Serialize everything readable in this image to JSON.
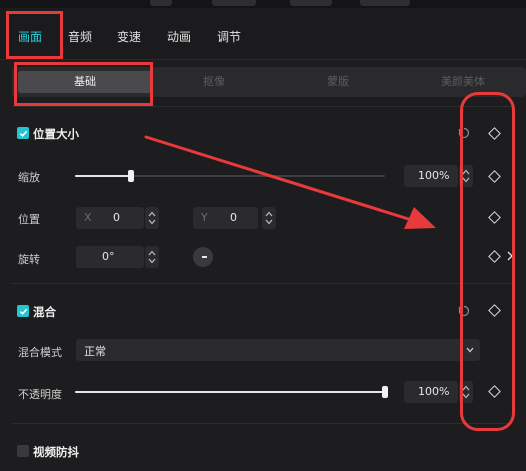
{
  "tabs": [
    "画面",
    "音频",
    "变速",
    "动画",
    "调节"
  ],
  "subtabs": [
    "基础",
    "抠像",
    "蒙版",
    "美颜美体"
  ],
  "sections": {
    "position_size": {
      "title": "位置大小",
      "scale_label": "缩放",
      "scale_value": "100%",
      "scale_level": 0.18,
      "position_label": "位置",
      "x_prefix": "X",
      "x_value": "0",
      "y_prefix": "Y",
      "y_value": "0",
      "rotate_label": "旋转",
      "rotate_value": "0°"
    },
    "blend": {
      "title": "混合",
      "mode_label": "混合模式",
      "mode_value": "正常",
      "opacity_label": "不透明度",
      "opacity_value": "100%",
      "opacity_level": 1.0
    },
    "stabilize": {
      "title": "视频防抖"
    }
  },
  "colors": {
    "accent": "#2ed1dc",
    "annotation_red": "#e83a3a",
    "background": "#1d1d1f"
  },
  "icons": [
    "check-icon",
    "reset-icon",
    "keyframe-diamond-icon",
    "stepper-icon",
    "chevron-down-icon",
    "chevron-right-icon",
    "rotation-dial-icon"
  ]
}
